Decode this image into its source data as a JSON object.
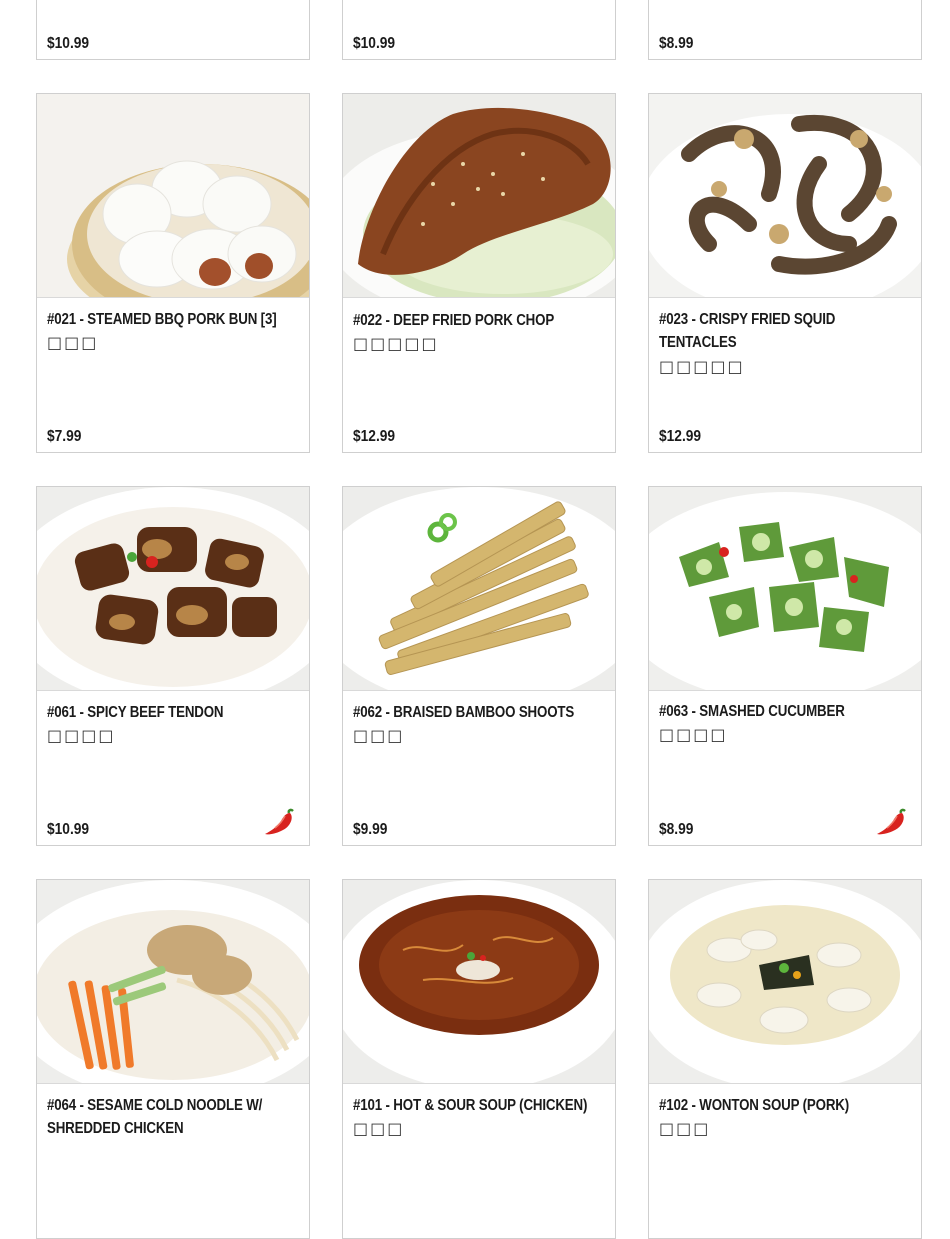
{
  "menu": {
    "top_row": [
      {
        "price": "$10.99"
      },
      {
        "price": "$10.99"
      },
      {
        "price": "$8.99"
      }
    ],
    "items": [
      {
        "title": "#021 - STEAMED BBQ PORK BUN [3]",
        "chinese": "□□□",
        "price": "$7.99",
        "spicy": false,
        "photo": "steamed-bbq-pork-bun-photo"
      },
      {
        "title": "#022 - DEEP FRIED PORK CHOP",
        "chinese": "□□□□□",
        "price": "$12.99",
        "spicy": false,
        "photo": "deep-fried-pork-chop-photo"
      },
      {
        "title_line1": "#023 - CRISPY FRIED SQUID",
        "title_line2": "TENTACLES",
        "chinese": "□□□□□",
        "price": "$12.99",
        "spicy": false,
        "photo": "crispy-fried-squid-photo"
      },
      {
        "title": "#061 - SPICY BEEF TENDON",
        "chinese": "□□□□",
        "price": "$10.99",
        "spicy": true,
        "photo": "spicy-beef-tendon-photo"
      },
      {
        "title": "#062 - BRAISED BAMBOO SHOOTS",
        "chinese": "□□□",
        "price": "$9.99",
        "spicy": false,
        "photo": "braised-bamboo-shoots-photo"
      },
      {
        "title": "#063 - SMASHED CUCUMBER",
        "chinese": "□□□□",
        "price": "$8.99",
        "spicy": true,
        "photo": "smashed-cucumber-photo"
      },
      {
        "title_line1": "#064 - SESAME COLD NOODLE W/",
        "title_line2": "SHREDDED CHICKEN",
        "photo": "sesame-cold-noodle-photo"
      },
      {
        "title": "#101 - HOT & SOUR SOUP (CHICKEN)",
        "chinese": "□□□",
        "photo": "hot-sour-soup-photo"
      },
      {
        "title": "#102 - WONTON SOUP (PORK)",
        "chinese": "□□□",
        "photo": "wonton-soup-photo"
      }
    ]
  },
  "icons": {
    "spicy": "chili-pepper-icon"
  },
  "colors": {
    "card_border": "#cfcfcf",
    "chili_red": "#d8231f"
  }
}
